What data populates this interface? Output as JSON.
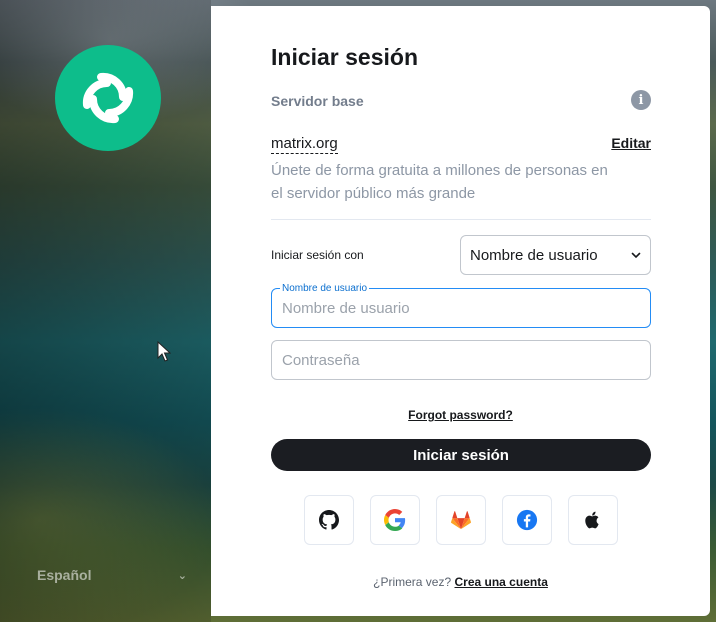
{
  "left": {
    "logo_icon": "element-logo-icon",
    "language": "Español"
  },
  "card": {
    "title": "Iniciar sesión",
    "server_heading": "Servidor base",
    "info_icon": "i",
    "server_name": "matrix.org",
    "edit_label": "Editar",
    "server_description": "Únete de forma gratuita a millones de personas en el servidor público más grande",
    "login_with_label": "Iniciar sesión con",
    "login_with_selected": "Nombre de usuario",
    "username_float_label": "Nombre de usuario",
    "username_placeholder": "Nombre de usuario",
    "password_placeholder": "Contraseña",
    "forgot_password": "Forgot password?",
    "submit_label": "Iniciar sesión",
    "sso_icons": [
      "github-icon",
      "google-icon",
      "gitlab-icon",
      "facebook-icon",
      "apple-icon"
    ],
    "signup_question": "¿Primera vez?",
    "signup_link": "Crea una cuenta"
  },
  "colors": {
    "accent": "#0dbd8b",
    "focus": "#238cf5",
    "button": "#1b1d22"
  }
}
